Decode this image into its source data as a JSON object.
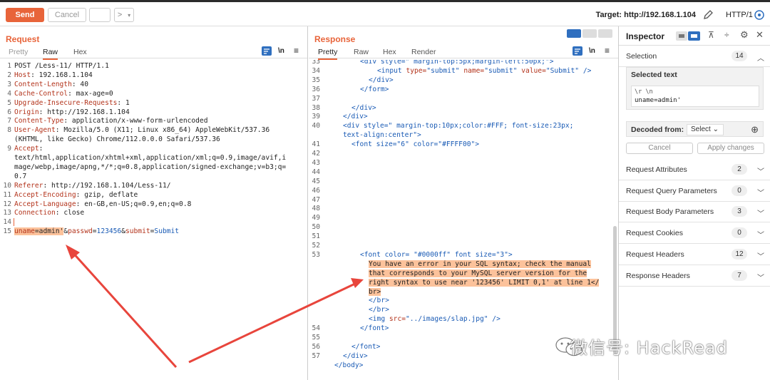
{
  "toolbar": {
    "send_label": "Send",
    "cancel_label": "Cancel",
    "target_label": "Target: http://192.168.1.104",
    "http_version": "HTTP/1"
  },
  "request": {
    "title": "Request",
    "tabs": [
      "Pretty",
      "Raw",
      "Hex"
    ],
    "active_tab": "Raw",
    "tool_ln": "\\n",
    "lines": [
      {
        "n": "1",
        "text": "POST /Less-11/ HTTP/1.1"
      },
      {
        "n": "2",
        "key": "Host",
        "val": " 192.168.1.104"
      },
      {
        "n": "3",
        "key": "Content-Length",
        "val": " 40"
      },
      {
        "n": "4",
        "key": "Cache-Control",
        "val": " max-age=0"
      },
      {
        "n": "5",
        "key": "Upgrade-Insecure-Requests",
        "val": " 1"
      },
      {
        "n": "6",
        "key": "Origin",
        "val": " http://192.168.1.104"
      },
      {
        "n": "7",
        "key": "Content-Type",
        "val": " application/x-www-form-urlencoded"
      },
      {
        "n": "8",
        "key": "User-Agent",
        "val": " Mozilla/5.0 (X11; Linux x86_64) AppleWebKit/537.36"
      },
      {
        "n": "",
        "text": "(KHTML, like Gecko) Chrome/112.0.0.0 Safari/537.36"
      },
      {
        "n": "9",
        "key": "Accept",
        "val": ""
      },
      {
        "n": "",
        "text": "text/html,application/xhtml+xml,application/xml;q=0.9,image/avif,i"
      },
      {
        "n": "",
        "text": "mage/webp,image/apng,*/*;q=0.8,application/signed-exchange;v=b3;q="
      },
      {
        "n": "",
        "text": "0.7"
      },
      {
        "n": "10",
        "key": "Referer",
        "val": " http://192.168.1.104/Less-11/"
      },
      {
        "n": "11",
        "key": "Accept-Encoding",
        "val": " gzip, deflate"
      },
      {
        "n": "12",
        "key": "Accept-Language",
        "val": " en-GB,en-US;q=0.9,en;q=0.8"
      },
      {
        "n": "13",
        "key": "Connection",
        "val": " close"
      },
      {
        "n": "14",
        "text": ""
      },
      {
        "n": "15",
        "body": true
      }
    ],
    "body": {
      "k1": "uname",
      "v1": "admin'",
      "k2": "passwd",
      "v2": "123456",
      "k3": "submit",
      "v3": "Submit"
    }
  },
  "response": {
    "title": "Response",
    "tabs": [
      "Pretty",
      "Raw",
      "Hex",
      "Render"
    ],
    "active_tab": "Pretty",
    "tool_ln": "\\n",
    "line_numbers": [
      "33",
      "34",
      "35",
      "36",
      "37",
      "38",
      "39",
      "40",
      "",
      "41",
      "42",
      "43",
      "44",
      "45",
      "46",
      "47",
      "48",
      "49",
      "50",
      "51",
      "52",
      "53",
      "",
      "",
      "",
      "",
      "",
      "",
      "",
      "54",
      "55",
      "56",
      "57"
    ],
    "code": {
      "l33": "<div style=\" margin-top:5px;margin-left:50px;\">",
      "l34": "<input type=\"submit\" name=\"submit\" value=\"Submit\" />",
      "l35": "</div>",
      "l36": "</form>",
      "l38": "</div>",
      "l39": "</div>",
      "l40a": "<div style=\" margin-top:10px;color:#FFF; font-size:23px;",
      "l40b": "text-align:center\">",
      "l41": "<font size=\"6\" color=\"#FFFF00\">",
      "l53": "<font color= \"#0000ff\" font size=\"3\">",
      "err1": "You have an error in your SQL syntax; check the manual",
      "err2": "that corresponds to your MySQL server version for the",
      "err3": "right syntax to use near '123456' LIMIT 0,1' at line 1</",
      "err4": "br>",
      "br1": "</br>",
      "br2": "</br>",
      "img": "<img src=\"../images/slap.jpg\" />",
      "fontclose1": "</font>",
      "fontclose2": "</font>",
      "divclose1": "</div>",
      "bodyclose": "</body>"
    }
  },
  "inspector": {
    "title": "Inspector",
    "selection_label": "Selection",
    "selection_count": "14",
    "selected_text_label": "Selected text",
    "selected_escapes": "\\r \\n",
    "selected_value": "uname=admin'",
    "decoded_from_label": "Decoded from:",
    "decoded_select": "Select",
    "cancel_label": "Cancel",
    "apply_label": "Apply changes",
    "sections": [
      {
        "label": "Request Attributes",
        "count": "2"
      },
      {
        "label": "Request Query Parameters",
        "count": "0"
      },
      {
        "label": "Request Body Parameters",
        "count": "3"
      },
      {
        "label": "Request Cookies",
        "count": "0"
      },
      {
        "label": "Request Headers",
        "count": "12"
      },
      {
        "label": "Response Headers",
        "count": "7"
      }
    ]
  },
  "watermark": "微信号: HackRead",
  "colors": {
    "accent": "#e8643a",
    "highlight": "#fcc29b",
    "arrow": "#e8453c",
    "blue": "#2f6fbf"
  }
}
